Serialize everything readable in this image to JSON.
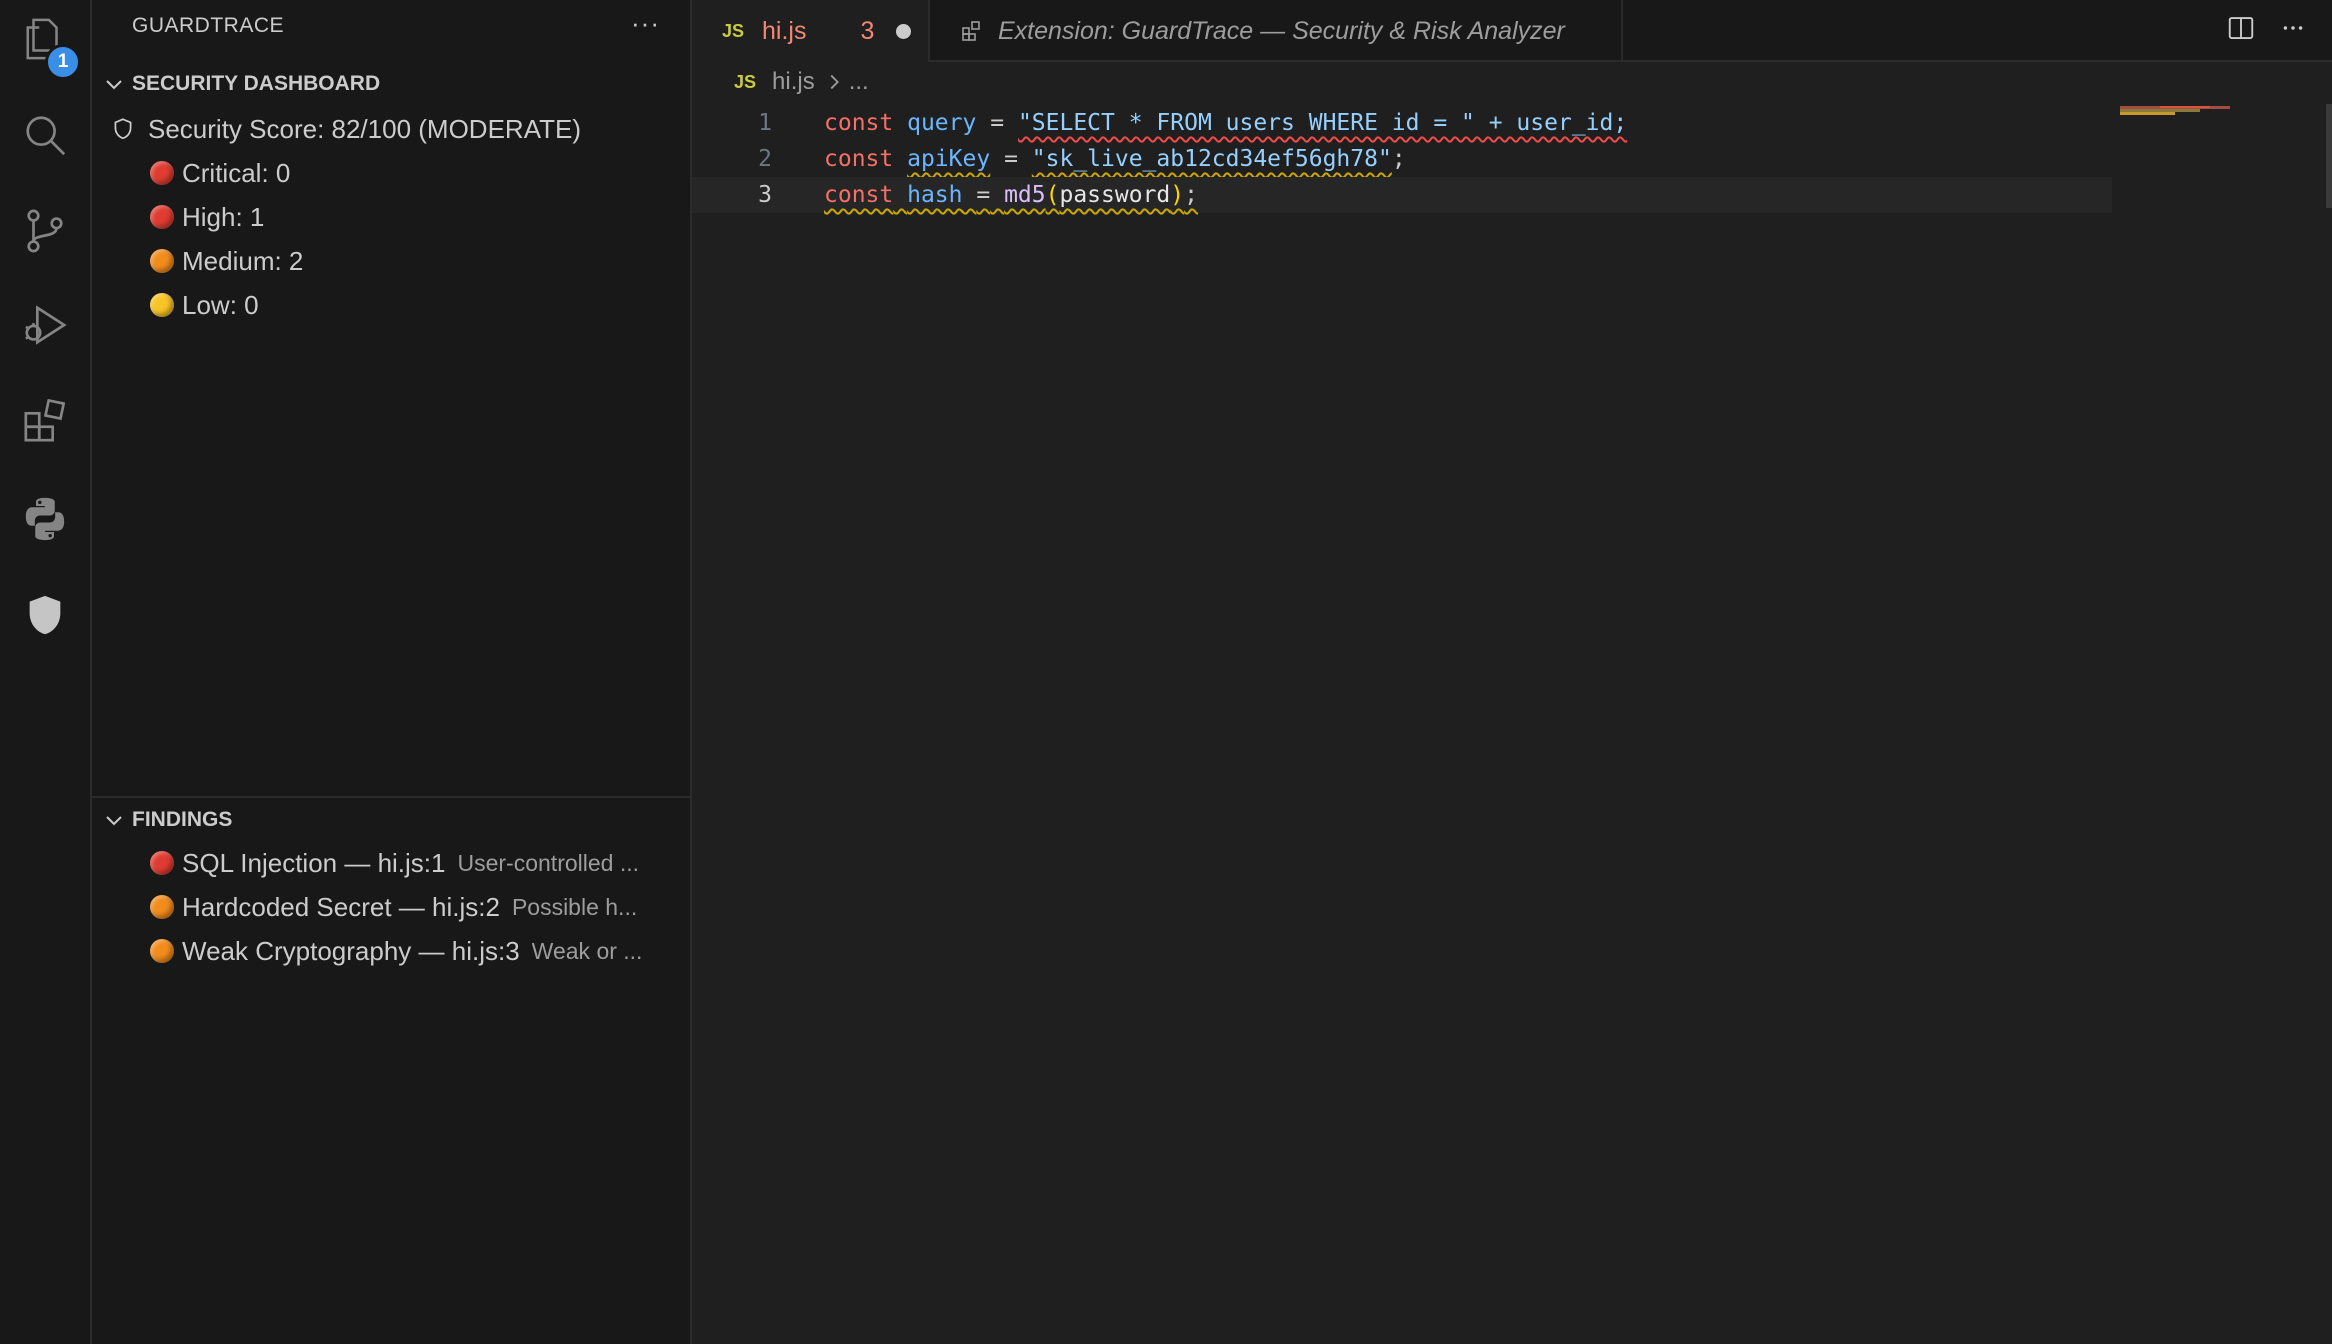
{
  "sidebar": {
    "title": "GUARDTRACE",
    "more": "···",
    "dashboard": {
      "header": "SECURITY DASHBOARD",
      "score": "Security Score: 82/100 (MODERATE)",
      "items": [
        {
          "label": "Critical: 0",
          "color": "#e03c31"
        },
        {
          "label": "High: 1",
          "color": "#e03c31"
        },
        {
          "label": "Medium: 2",
          "color": "#f28c1c"
        },
        {
          "label": "Low: 0",
          "color": "#f7c325"
        }
      ]
    },
    "findings": {
      "header": "FINDINGS",
      "items": [
        {
          "label": "SQL Injection — hi.js:1",
          "desc": "User-controlled ...",
          "color": "#e03c31"
        },
        {
          "label": "Hardcoded Secret — hi.js:2",
          "desc": "Possible h...",
          "color": "#f28c1c"
        },
        {
          "label": "Weak Cryptography — hi.js:3",
          "desc": "Weak or ...",
          "color": "#f28c1c"
        }
      ]
    }
  },
  "activity": {
    "explorer_badge": "1",
    "icons": [
      "files-icon",
      "search-icon",
      "source-control-icon",
      "run-debug-icon",
      "extensions-icon",
      "python-icon",
      "shield-icon"
    ]
  },
  "editor": {
    "tabs": [
      {
        "lang": "JS",
        "name": "hi.js",
        "problems": "3"
      },
      {
        "name": "Extension: GuardTrace — Security & Risk Analyzer"
      }
    ],
    "breadcrumb": {
      "lang": "JS",
      "file": "hi.js",
      "rest": "..."
    },
    "lines": [
      {
        "num": "1",
        "t0": "const",
        "t1": "query",
        "t2": "=",
        "t3": "\"SELECT * FROM users WHERE id = \" + user_id;"
      },
      {
        "num": "2",
        "t0": "const",
        "t1": "apiKey",
        "t2": "=",
        "t3": "\"sk_live_ab12cd34ef56gh78\"",
        "t4": ";"
      },
      {
        "num": "3",
        "t0": "const",
        "t1": "hash",
        "t2": "=",
        "t3": "md5",
        "t4": "(",
        "t5": "password",
        "t6": ")",
        "t7": ";"
      }
    ]
  }
}
